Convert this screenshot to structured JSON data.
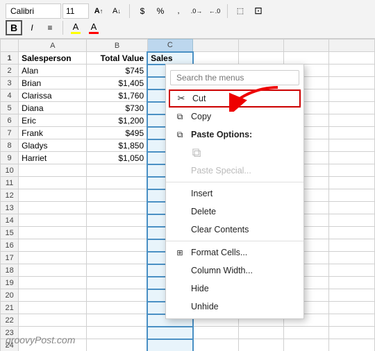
{
  "toolbar": {
    "font_name": "Calibri",
    "font_size": "11",
    "bold_label": "B",
    "italic_label": "I",
    "align_label": "≡",
    "highlight_label": "A",
    "font_color_label": "A",
    "increase_font": "A↑",
    "decrease_font": "A↓",
    "currency_label": "$",
    "percent_label": "%",
    "comma_label": ",",
    "increase_dec": ".0",
    "decrease_dec": ".00"
  },
  "columns": {
    "row_header": "",
    "col_a": "A",
    "col_b": "B",
    "col_c": "C"
  },
  "rows": [
    {
      "num": "1",
      "a": "Salesperson",
      "b": "Total Value",
      "c": "Sales",
      "is_header": true
    },
    {
      "num": "2",
      "a": "Alan",
      "b": "$745",
      "c": ""
    },
    {
      "num": "3",
      "a": "Brian",
      "b": "$1,405",
      "c": ""
    },
    {
      "num": "4",
      "a": "Clarissa",
      "b": "$1,760",
      "c": ""
    },
    {
      "num": "5",
      "a": "Diana",
      "b": "$730",
      "c": ""
    },
    {
      "num": "6",
      "a": "Eric",
      "b": "$1,200",
      "c": ""
    },
    {
      "num": "7",
      "a": "Frank",
      "b": "$495",
      "c": ""
    },
    {
      "num": "8",
      "a": "Gladys",
      "b": "$1,850",
      "c": ""
    },
    {
      "num": "9",
      "a": "Harriet",
      "b": "$1,050",
      "c": ""
    },
    {
      "num": "10",
      "a": "",
      "b": "",
      "c": ""
    },
    {
      "num": "11",
      "a": "",
      "b": "",
      "c": ""
    },
    {
      "num": "12",
      "a": "",
      "b": "",
      "c": ""
    },
    {
      "num": "13",
      "a": "",
      "b": "",
      "c": ""
    },
    {
      "num": "14",
      "a": "",
      "b": "",
      "c": ""
    },
    {
      "num": "15",
      "a": "",
      "b": "",
      "c": ""
    },
    {
      "num": "16",
      "a": "",
      "b": "",
      "c": ""
    },
    {
      "num": "17",
      "a": "",
      "b": "",
      "c": ""
    },
    {
      "num": "18",
      "a": "",
      "b": "",
      "c": ""
    },
    {
      "num": "19",
      "a": "",
      "b": "",
      "c": ""
    },
    {
      "num": "20",
      "a": "",
      "b": "",
      "c": ""
    },
    {
      "num": "21",
      "a": "",
      "b": "",
      "c": ""
    },
    {
      "num": "22",
      "a": "",
      "b": "",
      "c": ""
    },
    {
      "num": "23",
      "a": "",
      "b": "",
      "c": ""
    },
    {
      "num": "24",
      "a": "",
      "b": "",
      "c": ""
    }
  ],
  "watermark": "groovyPost.com",
  "context_menu": {
    "search_placeholder": "Search the menus",
    "items": [
      {
        "id": "cut",
        "label": "Cut",
        "icon": "✂",
        "disabled": false,
        "bold_border": true
      },
      {
        "id": "copy",
        "label": "Copy",
        "icon": "⧉",
        "disabled": false
      },
      {
        "id": "paste_options_label",
        "label": "Paste Options:",
        "icon": "⧉",
        "disabled": false,
        "is_section": true
      },
      {
        "id": "paste_icon",
        "label": "",
        "icon": "⧉",
        "disabled": true,
        "icon_only": true
      },
      {
        "id": "paste_special",
        "label": "Paste Special...",
        "icon": "",
        "disabled": true
      },
      {
        "id": "sep1",
        "separator": true
      },
      {
        "id": "insert",
        "label": "Insert",
        "icon": "",
        "disabled": false
      },
      {
        "id": "delete",
        "label": "Delete",
        "icon": "",
        "disabled": false
      },
      {
        "id": "clear_contents",
        "label": "Clear Contents",
        "icon": "",
        "disabled": false
      },
      {
        "id": "sep2",
        "separator": true
      },
      {
        "id": "format_cells",
        "label": "Format Cells...",
        "icon": "⊞",
        "disabled": false
      },
      {
        "id": "column_width",
        "label": "Column Width...",
        "icon": "",
        "disabled": false
      },
      {
        "id": "hide",
        "label": "Hide",
        "icon": "",
        "disabled": false
      },
      {
        "id": "unhide",
        "label": "Unhide",
        "icon": "",
        "disabled": false
      }
    ]
  }
}
